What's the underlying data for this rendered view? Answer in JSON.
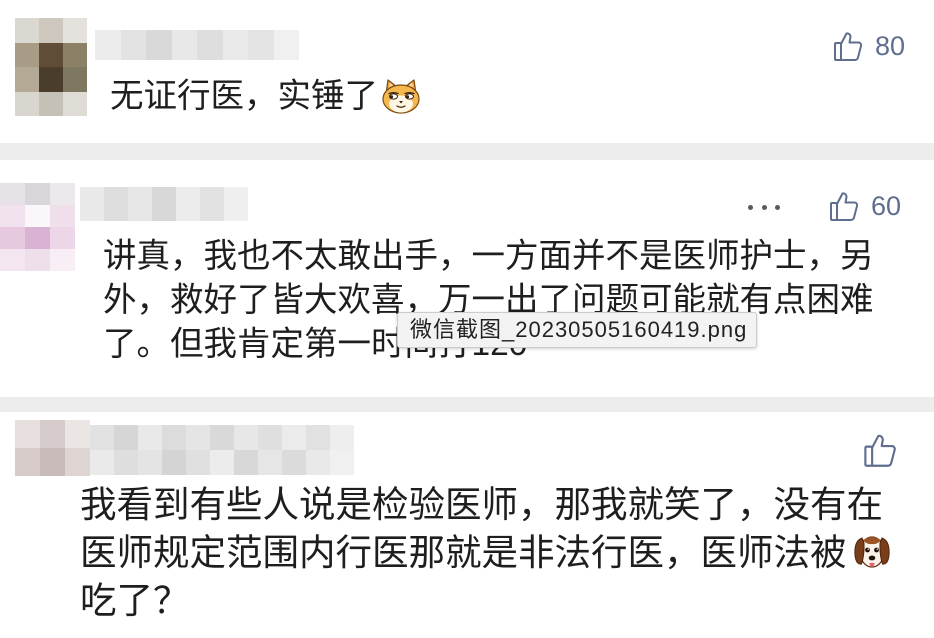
{
  "comments": [
    {
      "avatar_mosaic": [
        "#dbd8d2",
        "#cdc7bd",
        "#e5e2dd",
        "#a89c87",
        "#5f4d38",
        "#8c8066",
        "#b3a994",
        "#4b3d2c",
        "#7d785f",
        "#d9d6d0",
        "#c6c1b7",
        "#dfdcd6"
      ],
      "name_mosaic": [
        "#ececec",
        "#e3e3e3",
        "#d9d9d9",
        "#e8e8e8",
        "#dedede",
        "#eaeaea",
        "#e4e4e4",
        "#f0f0f0"
      ],
      "like_icon": "thumbs-up-icon",
      "likes": "80",
      "lines": [
        "无证行医，实锤了"
      ],
      "emoji": "smug-cat-emoji-icon"
    },
    {
      "avatar_mosaic": [
        "#e6e2e7",
        "#d9d5da",
        "#ebe9ec",
        "#f1e2ee",
        "#fbf6f9",
        "#eedfea",
        "#e6c8df",
        "#d9b3d3",
        "#edd6e8",
        "#f3e6f0",
        "#efdfeb",
        "#f7eff5"
      ],
      "name_mosaic": [
        "#e9e9e9",
        "#dedede",
        "#e6e6e6",
        "#d8d8d8",
        "#ebebeb",
        "#e2e2e2",
        "#efefef"
      ],
      "more_icon": "more-dots-icon",
      "like_icon": "thumbs-up-icon",
      "likes": "60",
      "lines": [
        "讲真，我也不太敢出手，一方面并不是医师护士，另",
        "外，救好了皆大欢喜，万一出了问题可能就有点困难",
        "了。但我肯定第一时间打120"
      ]
    },
    {
      "avatar_mosaic": [
        "#e6dfdd",
        "#d6cccb",
        "#ebe6e4",
        "#d8ccca",
        "#c9bbb9",
        "#ded4d2"
      ],
      "name_mosaic": [
        "#e2e2e2",
        "#d6d6d6",
        "#e9e9e9",
        "#dcdcdc",
        "#e5e5e5",
        "#d9d9d9",
        "#e7e7e7",
        "#dfdfdf",
        "#ebebeb",
        "#e1e1e1",
        "#eeeeee",
        "#eaeaea",
        "#dedede",
        "#e4e4e4",
        "#d4d4d4",
        "#e0e0e0",
        "#ececec",
        "#d8d8d8",
        "#e6e6e6",
        "#dbdbdb",
        "#e9e9e9",
        "#f0f0f0"
      ],
      "like_icon": "thumbs-up-icon",
      "lines": [
        "我看到有些人说是检验医师，那我就笑了，没有在",
        "医师规定范围内行医那就是非法行医，医师法被",
        "吃了？"
      ],
      "emoji": "dog-emoji-icon"
    }
  ],
  "tooltip": {
    "text": "微信截图_20230505160419.png"
  },
  "colors": {
    "background": "#ededed",
    "card": "#ffffff",
    "text": "#1e1e1e",
    "like": "#5f6e8e",
    "more_dots": "#5a5a5a",
    "tooltip_bg": "#f3f3f3",
    "tooltip_border": "#cccccc",
    "tooltip_text": "#222222"
  }
}
